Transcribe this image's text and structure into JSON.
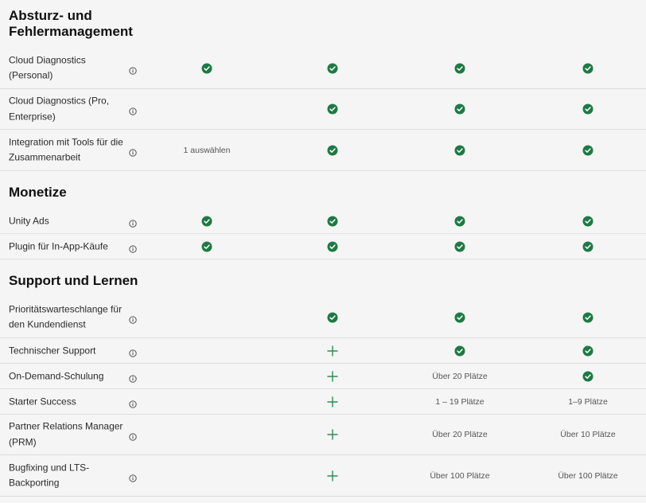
{
  "colors": {
    "check": "#1e7a45",
    "plus": "#2e8b57",
    "divider": "#dedede",
    "background": "#f5f5f5"
  },
  "icons": {
    "info": "info-circle-icon",
    "check": "check-circle-icon",
    "plus": "plus-icon"
  },
  "sections": [
    {
      "title": "Absturz- und Fehlermanagement",
      "rows": [
        {
          "label": "Cloud Diagnostics (Personal)",
          "cells": [
            {
              "type": "check"
            },
            {
              "type": "check"
            },
            {
              "type": "check"
            },
            {
              "type": "check"
            }
          ]
        },
        {
          "label": "Cloud Diagnostics (Pro, Enterprise)",
          "cells": [
            {
              "type": "empty"
            },
            {
              "type": "check"
            },
            {
              "type": "check"
            },
            {
              "type": "check"
            }
          ]
        },
        {
          "label": "Integration mit Tools für die Zusammenarbeit",
          "cells": [
            {
              "type": "text",
              "text": "1 auswählen"
            },
            {
              "type": "check"
            },
            {
              "type": "check"
            },
            {
              "type": "check"
            }
          ]
        }
      ]
    },
    {
      "title": "Monetize",
      "rows": [
        {
          "label": "Unity Ads",
          "cells": [
            {
              "type": "check"
            },
            {
              "type": "check"
            },
            {
              "type": "check"
            },
            {
              "type": "check"
            }
          ]
        },
        {
          "label": "Plugin für In-App-Käufe",
          "cells": [
            {
              "type": "check"
            },
            {
              "type": "check"
            },
            {
              "type": "check"
            },
            {
              "type": "check"
            }
          ]
        }
      ]
    },
    {
      "title": "Support und Lernen",
      "rows": [
        {
          "label": "Prioritätswarteschlange für den Kundendienst",
          "cells": [
            {
              "type": "empty"
            },
            {
              "type": "check"
            },
            {
              "type": "check"
            },
            {
              "type": "check"
            }
          ]
        },
        {
          "label": "Technischer Support",
          "cells": [
            {
              "type": "empty"
            },
            {
              "type": "plus"
            },
            {
              "type": "check"
            },
            {
              "type": "check"
            }
          ]
        },
        {
          "label": "On-Demand-Schulung",
          "cells": [
            {
              "type": "empty"
            },
            {
              "type": "plus"
            },
            {
              "type": "text",
              "text": "Über 20 Plätze"
            },
            {
              "type": "check"
            }
          ]
        },
        {
          "label": "Starter Success",
          "cells": [
            {
              "type": "empty"
            },
            {
              "type": "plus"
            },
            {
              "type": "text",
              "text": "1 – 19 Plätze"
            },
            {
              "type": "text",
              "text": "1–9 Plätze"
            }
          ]
        },
        {
          "label": "Partner Relations Manager (PRM)",
          "cells": [
            {
              "type": "empty"
            },
            {
              "type": "plus"
            },
            {
              "type": "text",
              "text": "Über 20 Plätze"
            },
            {
              "type": "text",
              "text": "Über 10 Plätze"
            }
          ]
        },
        {
          "label": "Bugfixing und LTS-Backporting",
          "cells": [
            {
              "type": "empty"
            },
            {
              "type": "plus"
            },
            {
              "type": "text",
              "text": "Über 100 Plätze"
            },
            {
              "type": "text",
              "text": "Über 100 Plätze"
            }
          ]
        }
      ]
    }
  ]
}
